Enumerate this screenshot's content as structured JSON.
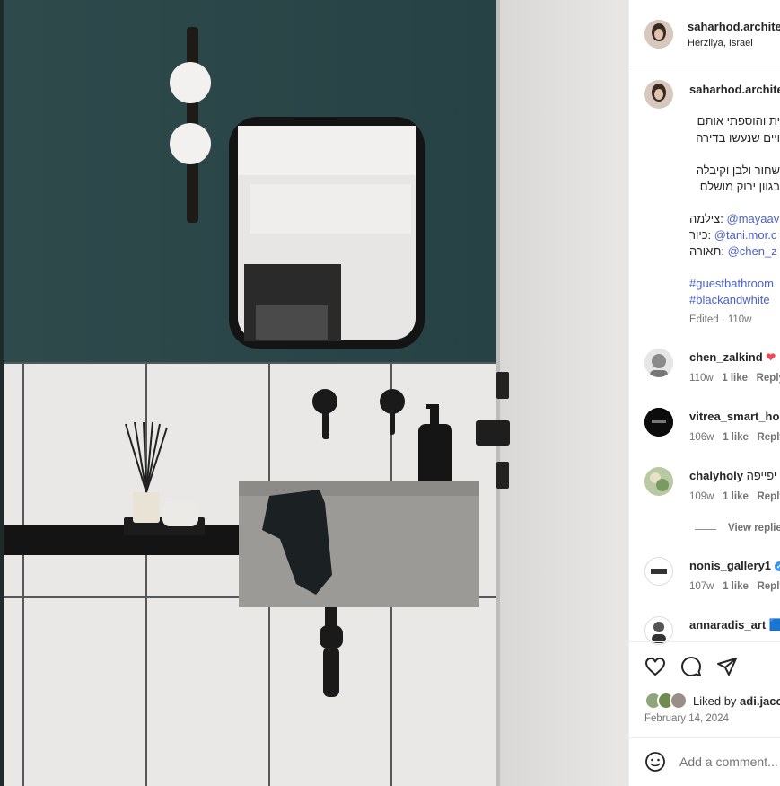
{
  "post": {
    "author": {
      "username": "saharhod.architect",
      "location": "Herzliya, Israel"
    },
    "caption": {
      "username": "saharhod.architect",
      "lines": [
        "ית והוספתי אותם",
        "ויים שנעשו בדירה",
        "שחור ולבן וקיבלה",
        "בגוון ירוק מושלם"
      ],
      "credits": [
        {
          "label": "צילמה:",
          "handle": "@mayaav"
        },
        {
          "label": "כיור:",
          "handle": "@tani.mor.c"
        },
        {
          "label": "תאורה:",
          "handle": "@chen_z"
        }
      ],
      "hashtags": [
        "#guestbathroom",
        "#blackandwhite"
      ],
      "edited": "Edited · 110w"
    },
    "comments": [
      {
        "username": "chen_zalkind",
        "text": "❤",
        "time": "110w",
        "likes": "1 like",
        "reply": "Reply"
      },
      {
        "username": "vitrea_smart_home",
        "text": "",
        "time": "106w",
        "likes": "1 like",
        "reply": "Reply"
      },
      {
        "username": "chalyholy",
        "text": "יפייפה",
        "time": "109w",
        "likes": "1 like",
        "reply": "Reply",
        "view_replies": "View replies"
      },
      {
        "username": "nonis_gallery1",
        "text": "",
        "time": "107w",
        "likes": "1 like",
        "reply": "Reply",
        "verified": true
      },
      {
        "username": "annaradis_art",
        "text": "🟦",
        "time": "",
        "likes": "",
        "reply": ""
      }
    ],
    "actions": {
      "like": "heart-icon",
      "comment": "comment-icon",
      "share": "share-icon"
    },
    "liked_by": {
      "prefix": "Liked by",
      "user": "adi.jacobs"
    },
    "date": "February 14, 2024",
    "comment_box": {
      "placeholder": "Add a comment..."
    },
    "colors": {
      "wall_green": "#2f4a4b",
      "link_blue": "#4b62c8",
      "heart_red": "#ed4956"
    }
  }
}
